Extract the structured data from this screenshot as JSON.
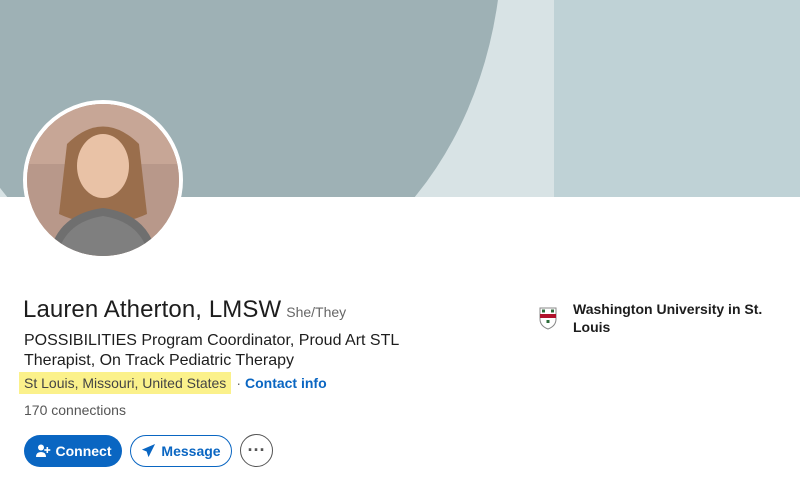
{
  "profile": {
    "name": "Lauren Atherton, LMSW",
    "pronouns": "She/They",
    "headline": "POSSIBILITIES Program Coordinator, Proud Art STL Therapist, On Track Pediatric Therapy",
    "location": "St Louis, Missouri, United States",
    "separator": "·",
    "contact_info": "Contact info",
    "connections": "170 connections"
  },
  "actions": {
    "connect_label": "Connect",
    "message_label": "Message",
    "more_label": "···"
  },
  "education": {
    "school": "Washington University in St. Louis"
  },
  "colors": {
    "accent": "#0a66c2",
    "highlight": "#fbf18b",
    "banner_dark": "#9eb1b5",
    "banner_light": "#d8e3e5",
    "banner_right": "#bfd2d6"
  },
  "icons": {
    "connect": "person-add-icon",
    "message": "paper-plane-icon",
    "more": "ellipsis-icon",
    "school": "university-shield-icon"
  }
}
